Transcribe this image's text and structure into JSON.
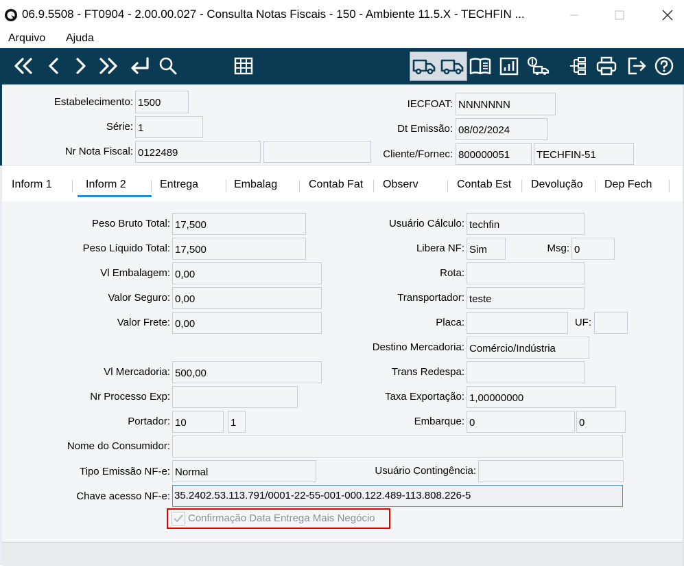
{
  "window": {
    "title": "06.9.5508 - FT0904 - 2.00.00.027 - Consulta Notas Fiscais - 150 - Ambiente 11.5.X - TECHFIN ...",
    "icons": [
      "app-logo-icon",
      "minimize-icon",
      "maximize-icon",
      "close-icon"
    ]
  },
  "menu": {
    "file": "Arquivo",
    "help": "Ajuda"
  },
  "toolbar": {
    "icons": [
      "first-record-icon",
      "previous-record-icon",
      "next-record-icon",
      "last-record-icon",
      "go-to-icon",
      "search-icon",
      "grid-icon",
      "truck-icon",
      "truck-icon",
      "book-icon",
      "chart-icon",
      "truck-dollar-icon",
      "hierarchy-icon",
      "print-icon",
      "exit-icon",
      "help-icon"
    ],
    "bg_color": "#0b3b52"
  },
  "header": {
    "estabelecimento_label": "Estabelecimento:",
    "estabelecimento_value": "1500",
    "serie_label": "Série:",
    "serie_value": "1",
    "nr_nota_label": "Nr Nota Fiscal:",
    "nr_nota_value": "0122489",
    "nr_nota_extra": "",
    "iecfoat_label": "IECFOAT:",
    "iecfoat_value": "NNNNNNN",
    "dt_emissao_label": "Dt Emissão:",
    "dt_emissao_value": "08/02/2024",
    "cliente_label": "Cliente/Fornec:",
    "cliente_code": "800000051",
    "cliente_name": "TECHFIN-51"
  },
  "tabs": [
    "Inform 1",
    "Inform 2",
    "Entrega",
    "Embalag",
    "Contab Fat",
    "Observ",
    "Contab Est",
    "Devolução",
    "Dep Fech"
  ],
  "active_tab": "Inform 2",
  "form": {
    "peso_bruto_label": "Peso Bruto Total:",
    "peso_bruto_value": "17,500",
    "peso_liquido_label": "Peso Líquido Total:",
    "peso_liquido_value": "17,500",
    "vl_embalagem_label": "Vl Embalagem:",
    "vl_embalagem_value": "0,00",
    "valor_seguro_label": "Valor Seguro:",
    "valor_seguro_value": "0,00",
    "valor_frete_label": "Valor Frete:",
    "valor_frete_value": "0,00",
    "vl_mercadoria_label": "Vl Mercadoria:",
    "vl_mercadoria_value": "500,00",
    "nr_processo_label": "Nr Processo Exp:",
    "nr_processo_value": "",
    "portador_label": "Portador:",
    "portador_value": "10",
    "portador_mod": "1",
    "nome_consumidor_label": "Nome do Consumidor:",
    "nome_consumidor_value": "",
    "tipo_emissao_label": "Tipo Emissão NF-e:",
    "tipo_emissao_value": "Normal",
    "chave_label": "Chave acesso NF-e:",
    "chave_value": "35.2402.53.113.791/0001-22-55-001-000.122.489-113.808.226-5",
    "usuario_calculo_label": "Usuário Cálculo:",
    "usuario_calculo_value": "techfin",
    "libera_nf_label": "Libera NF:",
    "libera_nf_value": "Sim",
    "msg_label": "Msg:",
    "msg_value": "0",
    "rota_label": "Rota:",
    "rota_value": "",
    "transportador_label": "Transportador:",
    "transportador_value": "teste",
    "placa_label": "Placa:",
    "placa_value": "",
    "uf_label": "UF:",
    "uf_value": "",
    "destino_label": "Destino Mercadoria:",
    "destino_value": "Comércio/Indústria",
    "trans_redespa_label": "Trans Redespa:",
    "trans_redespa_value": "",
    "taxa_exportacao_label": "Taxa Exportação:",
    "taxa_exportacao_value": "1,00000000",
    "embarque_label": "Embarque:",
    "embarque_value": "0",
    "embarque_seq": "0",
    "usuario_contingencia_label": "Usuário Contingência:",
    "usuario_contingencia_value": "",
    "confirmacao_label": "Confirmação Data Entrega Mais Negócio",
    "confirmacao_checked": true
  },
  "colors": {
    "highlight_border": "#e00000",
    "tab_underline": "#1f8fd9"
  }
}
